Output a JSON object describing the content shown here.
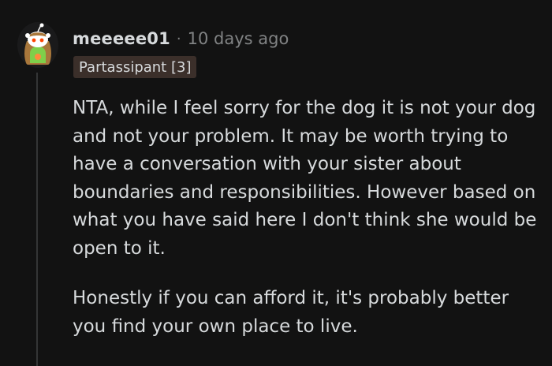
{
  "comment": {
    "author": "meeeee01",
    "separator": "·",
    "time_ago": "10 days ago",
    "flair": "Partassipant [3]",
    "avatar_icon": "reddit-snoo-avatar-icon",
    "paragraphs": [
      "NTA, while I feel sorry for the dog it is not your dog and not your problem. It may be worth trying to have a conversation with your sister about boundaries and responsibilities. However based on what you have said here I don't think she would be open to it.",
      "Honestly if you can afford it, it's probably better you find your own place to live."
    ]
  },
  "colors": {
    "background": "#121212",
    "text": "#d7dadc",
    "muted": "#818384",
    "flair_bg": "#3b2f2a",
    "thread_line": "#343536"
  }
}
